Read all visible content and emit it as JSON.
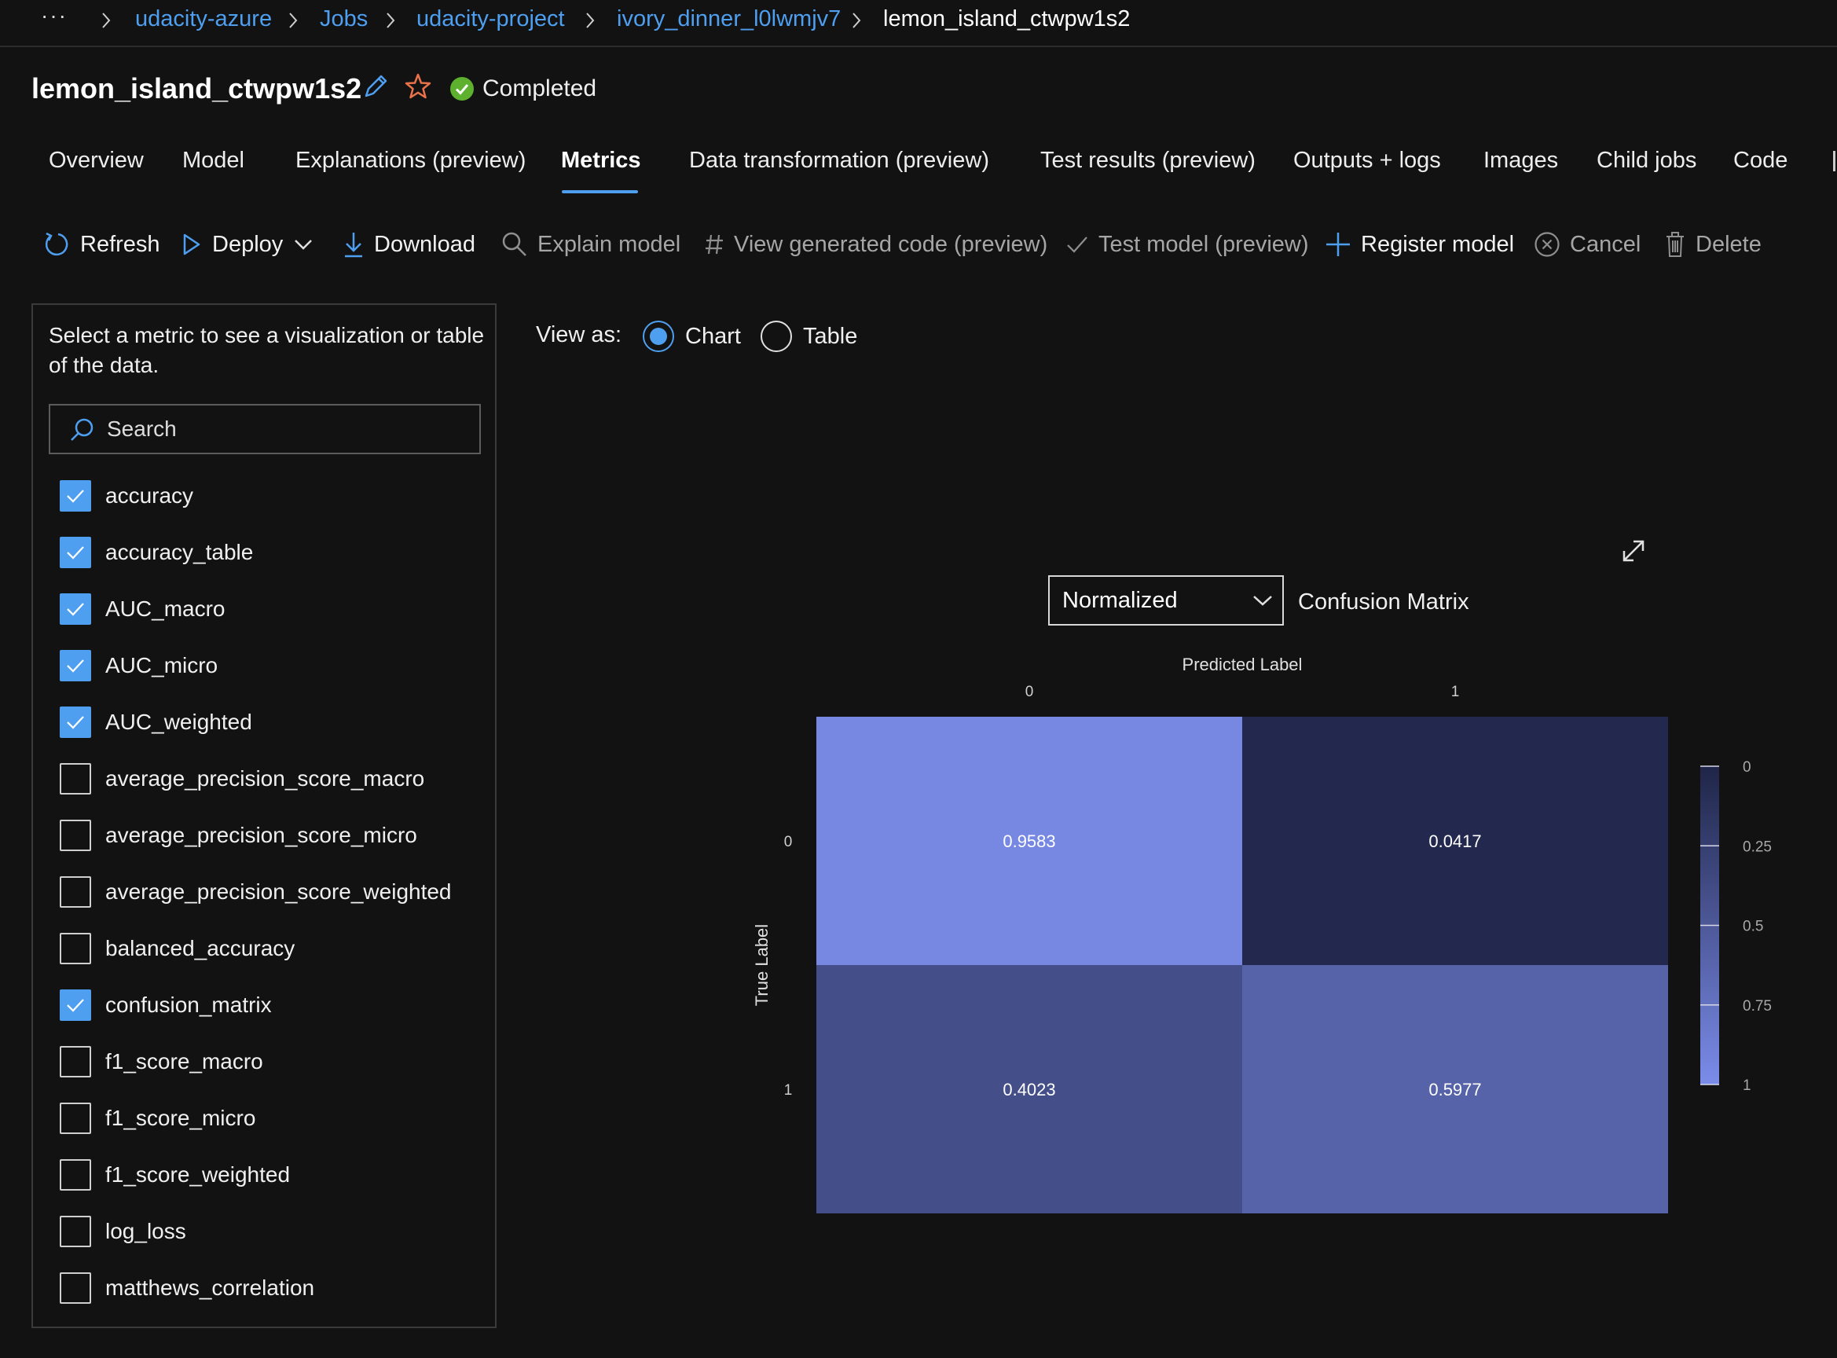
{
  "breadcrumb": {
    "overflow": "···",
    "items": [
      "udacity-azure",
      "Jobs",
      "udacity-project",
      "ivory_dinner_l0lwmjv7"
    ],
    "current": "lemon_island_ctwpw1s2"
  },
  "header": {
    "title": "lemon_island_ctwpw1s2",
    "status": "Completed",
    "status_color": "#5db12f"
  },
  "tabs": [
    {
      "label": "Overview"
    },
    {
      "label": "Model"
    },
    {
      "label": "Explanations (preview)"
    },
    {
      "label": "Metrics",
      "active": true
    },
    {
      "label": "Data transformation (preview)"
    },
    {
      "label": "Test results (preview)"
    },
    {
      "label": "Outputs + logs"
    },
    {
      "label": "Images"
    },
    {
      "label": "Child jobs"
    },
    {
      "label": "Code"
    }
  ],
  "toolbar": {
    "refresh": "Refresh",
    "deploy": "Deploy",
    "download": "Download",
    "explain": "Explain model",
    "view_code": "View generated code (preview)",
    "test_model": "Test model (preview)",
    "register": "Register model",
    "cancel": "Cancel",
    "delete": "Delete"
  },
  "metrics_panel": {
    "description": "Select a metric to see a visualization or table of the data.",
    "search_placeholder": "Search",
    "items": [
      {
        "label": "accuracy",
        "checked": true
      },
      {
        "label": "accuracy_table",
        "checked": true
      },
      {
        "label": "AUC_macro",
        "checked": true
      },
      {
        "label": "AUC_micro",
        "checked": true
      },
      {
        "label": "AUC_weighted",
        "checked": true
      },
      {
        "label": "average_precision_score_macro",
        "checked": false
      },
      {
        "label": "average_precision_score_micro",
        "checked": false
      },
      {
        "label": "average_precision_score_weighted",
        "checked": false
      },
      {
        "label": "balanced_accuracy",
        "checked": false
      },
      {
        "label": "confusion_matrix",
        "checked": true
      },
      {
        "label": "f1_score_macro",
        "checked": false
      },
      {
        "label": "f1_score_micro",
        "checked": false
      },
      {
        "label": "f1_score_weighted",
        "checked": false
      },
      {
        "label": "log_loss",
        "checked": false
      },
      {
        "label": "matthews_correlation",
        "checked": false
      }
    ]
  },
  "view": {
    "label": "View as:",
    "options": [
      "Chart",
      "Table"
    ],
    "selected": "Chart"
  },
  "chart_controls": {
    "normalization": "Normalized",
    "title": "Confusion Matrix"
  },
  "colors": {
    "accent": "#4f9ff0",
    "heat_low": "#1f2547",
    "heat_high": "#7b8cea"
  },
  "chart_data": {
    "type": "heatmap",
    "title": "Confusion Matrix",
    "xlabel": "Predicted Label",
    "ylabel": "True Label",
    "x_categories": [
      "0",
      "1"
    ],
    "y_categories": [
      "0",
      "1"
    ],
    "values": [
      [
        0.9583,
        0.0417
      ],
      [
        0.4023,
        0.5977
      ]
    ],
    "colorbar": {
      "ticks": [
        "0",
        "0.25",
        "0.5",
        "0.75",
        "1"
      ],
      "range": [
        0,
        1
      ]
    }
  }
}
